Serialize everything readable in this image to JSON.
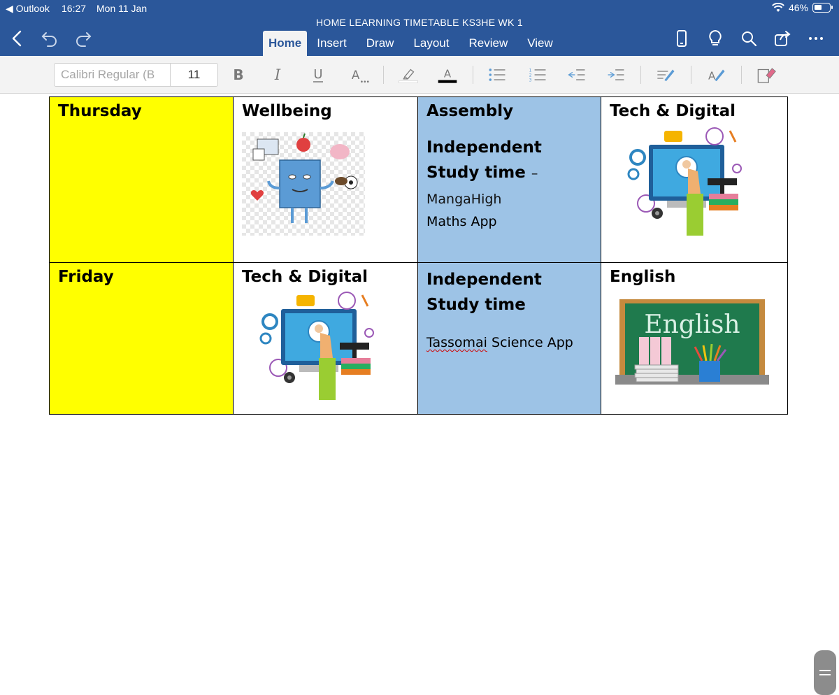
{
  "status_bar": {
    "back_app": "◀ Outlook",
    "time": "16:27",
    "date": "Mon 11 Jan",
    "battery": "46%"
  },
  "document_title": "HOME LEARNING TIMETABLE KS3HE WK 1",
  "tabs": [
    "Home",
    "Insert",
    "Draw",
    "Layout",
    "Review",
    "View"
  ],
  "active_tab": "Home",
  "ribbon": {
    "font_name": "Calibri Regular (B",
    "font_size": "11"
  },
  "colors": {
    "brand": "#2b579a",
    "day_cell": "#ffff00",
    "study_cell": "#9dc3e6"
  },
  "timetable": [
    {
      "day": "Thursday",
      "col2": {
        "title": "Wellbeing",
        "image": "wellbeing-illustration"
      },
      "col3": {
        "title": "Assembly",
        "study_title": "Independent Study time",
        "dash": "–",
        "app": "MangaHigh",
        "app2": "Maths App"
      },
      "col4": {
        "title": "Tech & Digital",
        "image": "tech-digital-illustration"
      }
    },
    {
      "day": "Friday",
      "col2": {
        "title": "Tech & Digital",
        "image": "tech-digital-illustration"
      },
      "col3": {
        "title": "Independent Study time",
        "app_word": "Tassomai",
        "app_rest": "Science App"
      },
      "col4": {
        "title": "English",
        "image": "english-chalkboard",
        "board_text": "English"
      }
    }
  ]
}
